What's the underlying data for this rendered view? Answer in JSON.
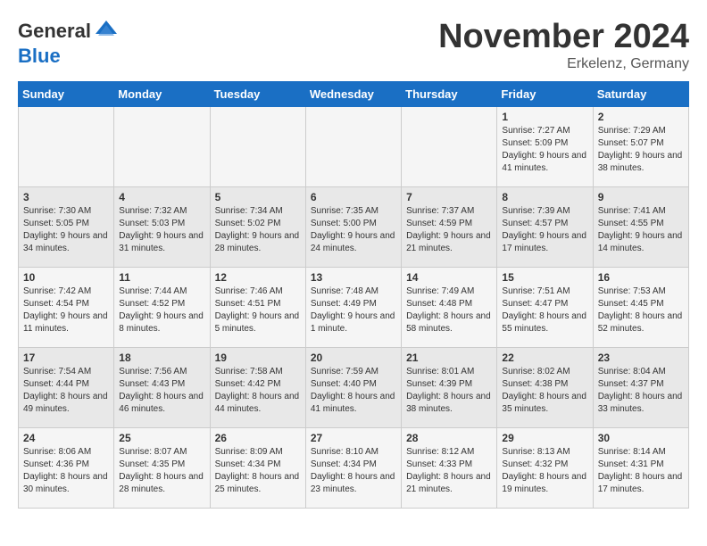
{
  "header": {
    "logo_general": "General",
    "logo_blue": "Blue",
    "month_title": "November 2024",
    "subtitle": "Erkelenz, Germany"
  },
  "days_of_week": [
    "Sunday",
    "Monday",
    "Tuesday",
    "Wednesday",
    "Thursday",
    "Friday",
    "Saturday"
  ],
  "weeks": [
    [
      {
        "day": "",
        "info": ""
      },
      {
        "day": "",
        "info": ""
      },
      {
        "day": "",
        "info": ""
      },
      {
        "day": "",
        "info": ""
      },
      {
        "day": "",
        "info": ""
      },
      {
        "day": "1",
        "info": "Sunrise: 7:27 AM\nSunset: 5:09 PM\nDaylight: 9 hours and 41 minutes."
      },
      {
        "day": "2",
        "info": "Sunrise: 7:29 AM\nSunset: 5:07 PM\nDaylight: 9 hours and 38 minutes."
      }
    ],
    [
      {
        "day": "3",
        "info": "Sunrise: 7:30 AM\nSunset: 5:05 PM\nDaylight: 9 hours and 34 minutes."
      },
      {
        "day": "4",
        "info": "Sunrise: 7:32 AM\nSunset: 5:03 PM\nDaylight: 9 hours and 31 minutes."
      },
      {
        "day": "5",
        "info": "Sunrise: 7:34 AM\nSunset: 5:02 PM\nDaylight: 9 hours and 28 minutes."
      },
      {
        "day": "6",
        "info": "Sunrise: 7:35 AM\nSunset: 5:00 PM\nDaylight: 9 hours and 24 minutes."
      },
      {
        "day": "7",
        "info": "Sunrise: 7:37 AM\nSunset: 4:59 PM\nDaylight: 9 hours and 21 minutes."
      },
      {
        "day": "8",
        "info": "Sunrise: 7:39 AM\nSunset: 4:57 PM\nDaylight: 9 hours and 17 minutes."
      },
      {
        "day": "9",
        "info": "Sunrise: 7:41 AM\nSunset: 4:55 PM\nDaylight: 9 hours and 14 minutes."
      }
    ],
    [
      {
        "day": "10",
        "info": "Sunrise: 7:42 AM\nSunset: 4:54 PM\nDaylight: 9 hours and 11 minutes."
      },
      {
        "day": "11",
        "info": "Sunrise: 7:44 AM\nSunset: 4:52 PM\nDaylight: 9 hours and 8 minutes."
      },
      {
        "day": "12",
        "info": "Sunrise: 7:46 AM\nSunset: 4:51 PM\nDaylight: 9 hours and 5 minutes."
      },
      {
        "day": "13",
        "info": "Sunrise: 7:48 AM\nSunset: 4:49 PM\nDaylight: 9 hours and 1 minute."
      },
      {
        "day": "14",
        "info": "Sunrise: 7:49 AM\nSunset: 4:48 PM\nDaylight: 8 hours and 58 minutes."
      },
      {
        "day": "15",
        "info": "Sunrise: 7:51 AM\nSunset: 4:47 PM\nDaylight: 8 hours and 55 minutes."
      },
      {
        "day": "16",
        "info": "Sunrise: 7:53 AM\nSunset: 4:45 PM\nDaylight: 8 hours and 52 minutes."
      }
    ],
    [
      {
        "day": "17",
        "info": "Sunrise: 7:54 AM\nSunset: 4:44 PM\nDaylight: 8 hours and 49 minutes."
      },
      {
        "day": "18",
        "info": "Sunrise: 7:56 AM\nSunset: 4:43 PM\nDaylight: 8 hours and 46 minutes."
      },
      {
        "day": "19",
        "info": "Sunrise: 7:58 AM\nSunset: 4:42 PM\nDaylight: 8 hours and 44 minutes."
      },
      {
        "day": "20",
        "info": "Sunrise: 7:59 AM\nSunset: 4:40 PM\nDaylight: 8 hours and 41 minutes."
      },
      {
        "day": "21",
        "info": "Sunrise: 8:01 AM\nSunset: 4:39 PM\nDaylight: 8 hours and 38 minutes."
      },
      {
        "day": "22",
        "info": "Sunrise: 8:02 AM\nSunset: 4:38 PM\nDaylight: 8 hours and 35 minutes."
      },
      {
        "day": "23",
        "info": "Sunrise: 8:04 AM\nSunset: 4:37 PM\nDaylight: 8 hours and 33 minutes."
      }
    ],
    [
      {
        "day": "24",
        "info": "Sunrise: 8:06 AM\nSunset: 4:36 PM\nDaylight: 8 hours and 30 minutes."
      },
      {
        "day": "25",
        "info": "Sunrise: 8:07 AM\nSunset: 4:35 PM\nDaylight: 8 hours and 28 minutes."
      },
      {
        "day": "26",
        "info": "Sunrise: 8:09 AM\nSunset: 4:34 PM\nDaylight: 8 hours and 25 minutes."
      },
      {
        "day": "27",
        "info": "Sunrise: 8:10 AM\nSunset: 4:34 PM\nDaylight: 8 hours and 23 minutes."
      },
      {
        "day": "28",
        "info": "Sunrise: 8:12 AM\nSunset: 4:33 PM\nDaylight: 8 hours and 21 minutes."
      },
      {
        "day": "29",
        "info": "Sunrise: 8:13 AM\nSunset: 4:32 PM\nDaylight: 8 hours and 19 minutes."
      },
      {
        "day": "30",
        "info": "Sunrise: 8:14 AM\nSunset: 4:31 PM\nDaylight: 8 hours and 17 minutes."
      }
    ]
  ]
}
